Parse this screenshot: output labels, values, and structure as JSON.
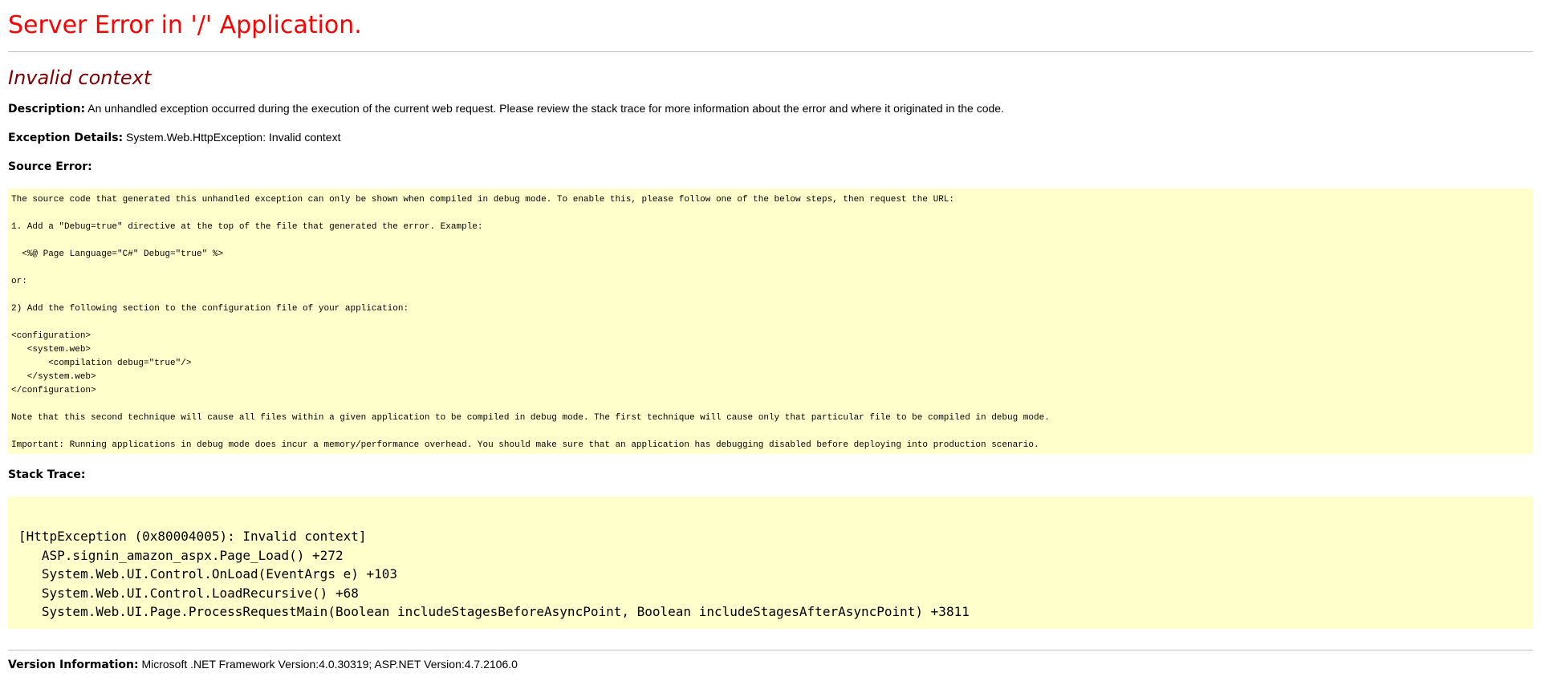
{
  "header": {
    "title": "Server Error in '/' Application."
  },
  "error": {
    "title": "Invalid context"
  },
  "description": {
    "label": "Description:",
    "text": " An unhandled exception occurred during the execution of the current web request. Please review the stack trace for more information about the error and where it originated in the code."
  },
  "exception_details": {
    "label": "Exception Details:",
    "text": " System.Web.HttpException: Invalid context"
  },
  "source_error": {
    "label": "Source Error:",
    "code": "The source code that generated this unhandled exception can only be shown when compiled in debug mode. To enable this, please follow one of the below steps, then request the URL:\n\n1. Add a \"Debug=true\" directive at the top of the file that generated the error. Example:\n\n  <%@ Page Language=\"C#\" Debug=\"true\" %>\n\nor:\n\n2) Add the following section to the configuration file of your application:\n\n<configuration>\n   <system.web>\n       <compilation debug=\"true\"/>\n   </system.web>\n</configuration>\n\nNote that this second technique will cause all files within a given application to be compiled in debug mode. The first technique will cause only that particular file to be compiled in debug mode.\n\nImportant: Running applications in debug mode does incur a memory/performance overhead. You should make sure that an application has debugging disabled before deploying into production scenario."
  },
  "stack_trace": {
    "label": "Stack Trace:",
    "code": "[HttpException (0x80004005): Invalid context]\n   ASP.signin_amazon_aspx.Page_Load() +272\n   System.Web.UI.Control.OnLoad(EventArgs e) +103\n   System.Web.UI.Control.LoadRecursive() +68\n   System.Web.UI.Page.ProcessRequestMain(Boolean includeStagesBeforeAsyncPoint, Boolean includeStagesAfterAsyncPoint) +3811"
  },
  "version_info": {
    "label": "Version Information:",
    "text": " Microsoft .NET Framework Version:4.0.30319; ASP.NET Version:4.7.2106.0"
  },
  "colors": {
    "title_red": "#ff0000",
    "error_maroon": "#800000",
    "code_background": "#ffffcc",
    "rule_gray": "#c0c0c0"
  }
}
